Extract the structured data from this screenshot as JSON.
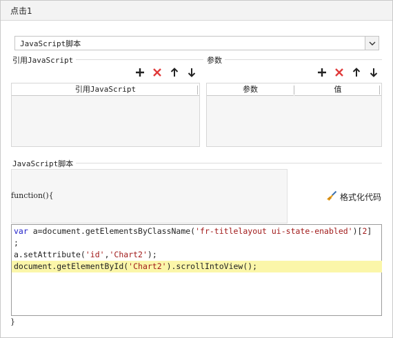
{
  "window": {
    "title": "点击1"
  },
  "script_type_select": {
    "value": "JavaScript脚本"
  },
  "ref_section": {
    "label": "引用JavaScript",
    "column_header": "引用JavaScript"
  },
  "param_section": {
    "label": "参数",
    "columns": [
      "参数",
      "值"
    ]
  },
  "script_section": {
    "label": "JavaScript脚本",
    "function_open": "function(){",
    "function_close": "}",
    "format_button": "格式化代码"
  },
  "code": {
    "line1_kw": "var",
    "line1_a": " a=document.getElementsByClassName(",
    "line1_str": "'fr-titlelayout ui-state-enabled'",
    "line1_b": ")[",
    "line1_num": "2",
    "line1_c": "]",
    "line2": ";",
    "line3_a": "a.setAttribute(",
    "line3_str1": "'id'",
    "line3_comma": ",",
    "line3_str2": "'Chart2'",
    "line3_b": ");",
    "line4_a": "document.getElementById(",
    "line4_str": "'Chart2'",
    "line4_b": ").scrollIntoView();"
  },
  "icons": {
    "add": "plus-icon",
    "delete": "x-icon",
    "up": "arrow-up-icon",
    "down": "arrow-down-icon",
    "format": "broom-icon",
    "dropdown": "chevron-down-icon"
  },
  "colors": {
    "delete": "#e03a3a",
    "highlight": "#fbf6a9",
    "keyword": "#2020c8",
    "string": "#a11a1a"
  }
}
